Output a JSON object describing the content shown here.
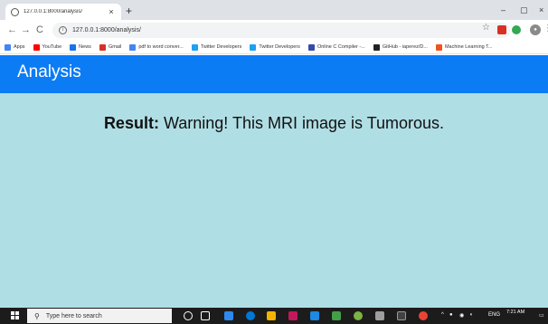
{
  "browser": {
    "tab_title": "127.0.0.1:8000/analysis/",
    "tab_close": "×",
    "new_tab": "+",
    "minimize": "–",
    "maximize": "▢",
    "close": "×",
    "back": "←",
    "forward": "→",
    "reload": "C",
    "url": "127.0.0.1:8000/analysis/",
    "star": "☆",
    "menu": "⋮"
  },
  "bookmarks": [
    {
      "label": "Apps",
      "color": "#4285f4"
    },
    {
      "label": "YouTube",
      "color": "#ff0000"
    },
    {
      "label": "News",
      "color": "#1a73e8"
    },
    {
      "label": "Gmail",
      "color": "#d93025"
    },
    {
      "label": "pdf to word conver...",
      "color": "#4285f4"
    },
    {
      "label": "Twitter Developers",
      "color": "#1da1f2"
    },
    {
      "label": "Twitter Developers",
      "color": "#1da1f2"
    },
    {
      "label": "Online C Compiler -...",
      "color": "#3949ab"
    },
    {
      "label": "GitHub - iaperez/D...",
      "color": "#222222"
    },
    {
      "label": "Machine Learning T...",
      "color": "#f4511e"
    }
  ],
  "page": {
    "brand": "Analysis",
    "result_label": "Result:",
    "result_message": " Warning! This MRI image is Tumorous."
  },
  "taskbar": {
    "search_placeholder": "Type here to search",
    "language": "ENG",
    "time": "7:21 AM"
  },
  "colors": {
    "navbar": "#0c7cf5",
    "content_bg": "#b0dee5"
  }
}
